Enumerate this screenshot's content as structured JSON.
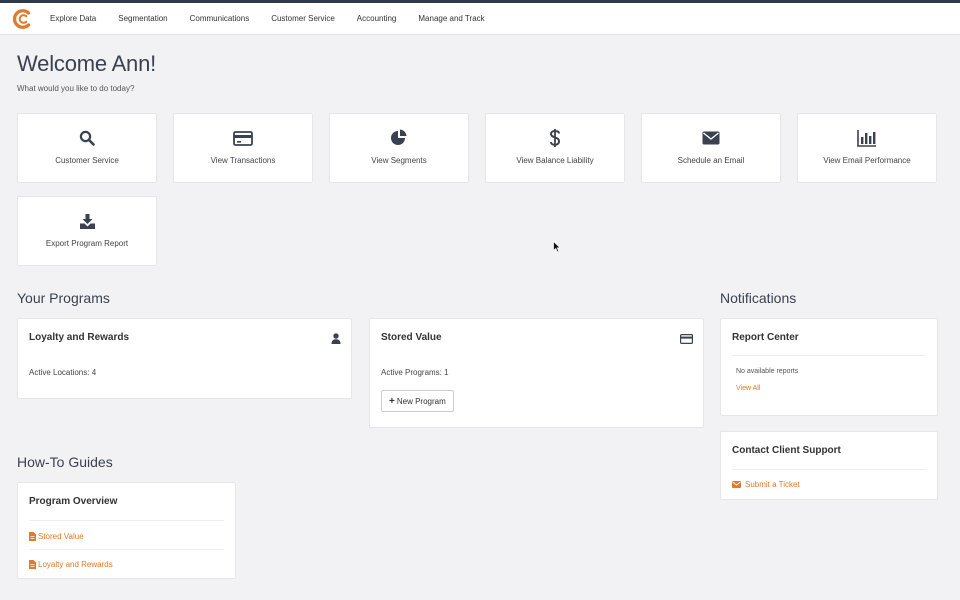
{
  "nav": {
    "items": [
      "Explore Data",
      "Segmentation",
      "Communications",
      "Customer Service",
      "Accounting",
      "Manage and Track"
    ]
  },
  "header": {
    "title": "Welcome Ann!",
    "subtitle": "What would you like to do today?"
  },
  "quick_actions": [
    {
      "label": "Customer Service",
      "icon": "search-icon"
    },
    {
      "label": "View Transactions",
      "icon": "credit-card-icon"
    },
    {
      "label": "View Segments",
      "icon": "pie-chart-icon"
    },
    {
      "label": "View Balance Liability",
      "icon": "dollar-icon"
    },
    {
      "label": "Schedule an Email",
      "icon": "envelope-icon"
    },
    {
      "label": "View Email Performance",
      "icon": "bar-chart-icon"
    },
    {
      "label": "Export Program Report",
      "icon": "download-icon"
    }
  ],
  "programs": {
    "title": "Your Programs",
    "loyalty": {
      "title": "Loyalty and Rewards",
      "detail": "Active Locations: 4",
      "icon": "user-icon"
    },
    "stored_value": {
      "title": "Stored Value",
      "detail": "Active Programs: 1",
      "button": "New Program",
      "icon": "credit-card-icon"
    }
  },
  "notifications": {
    "title": "Notifications",
    "report_center": {
      "title": "Report Center",
      "empty_text": "No available reports",
      "link": "View All"
    },
    "support": {
      "title": "Contact Client Support",
      "link": "Submit a Ticket",
      "icon": "envelope-icon"
    }
  },
  "guides": {
    "title": "How-To Guides",
    "card_title": "Program Overview",
    "links": [
      "Stored Value",
      "Loyalty and Rewards"
    ]
  },
  "colors": {
    "accent": "#e07a2c",
    "heading": "#3a4150",
    "topbar": "#2f3a4c",
    "icon": "#3a4150"
  }
}
